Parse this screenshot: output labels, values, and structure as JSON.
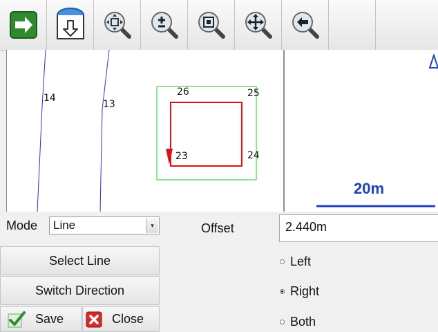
{
  "toolbar": {
    "buttons": [
      {
        "name": "next-icon"
      },
      {
        "name": "import-download-icon"
      },
      {
        "name": "zoom-extents-icon"
      },
      {
        "name": "zoom-in-out-icon"
      },
      {
        "name": "zoom-window-icon"
      },
      {
        "name": "pan-icon"
      },
      {
        "name": "zoom-previous-icon"
      }
    ]
  },
  "map": {
    "points": {
      "p14": "14",
      "p13": "13",
      "p26": "26",
      "p25": "25",
      "p23": "23",
      "p24": "24"
    },
    "scale_bar": "20m",
    "colors": {
      "selection": "#dd1111",
      "box": "#66dd66",
      "lines": "#2233cc",
      "scale": "#1f3fbf"
    }
  },
  "form": {
    "mode_label": "Mode",
    "mode_value": "Line",
    "offset_label": "Offset",
    "offset_value": "2.440m",
    "select_line": "Select Line",
    "switch_direction": "Switch Direction",
    "save": "Save",
    "close": "Close",
    "radio": [
      {
        "label": "Left",
        "selected": false
      },
      {
        "label": "Right",
        "selected": true
      },
      {
        "label": "Both",
        "selected": false
      }
    ]
  }
}
